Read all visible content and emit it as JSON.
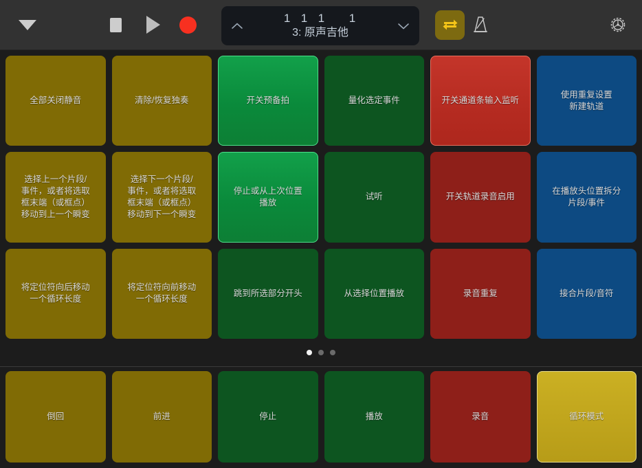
{
  "toolbar": {
    "menu_icon": "triangle-down-icon",
    "stop_icon": "stop-icon",
    "play_icon": "play-icon",
    "record_icon": "record-icon",
    "cycle_icon": "cycle-loop-icon",
    "cycle_active": true,
    "metronome_icon": "metronome-icon",
    "settings_icon": "gear-icon",
    "display": {
      "up_arrow_icon": "chevron-up-icon",
      "down_arrow_icon": "chevron-down-icon",
      "position": "1  1  1     1",
      "track": "3: 原声吉他"
    }
  },
  "colors": {
    "background": "#1c1c1c",
    "toolbar": "#323232",
    "lcd": "#15181d",
    "olive": "#806b05",
    "green": "#0d5520",
    "red": "#8e1f19",
    "blue": "#0d4a82",
    "green_active": "#0a8a3b",
    "red_active": "#b52b21",
    "olive_active": "#bfa41c",
    "cycle_badge": "#7d6a10",
    "cycle_glyph": "#f5c518",
    "record_glyph": "#f83020",
    "text": "#d8d8d8",
    "lcd_text": "#c8d2dd"
  },
  "grid": {
    "rows": [
      [
        {
          "label": "全部关闭静音",
          "color": "olive",
          "active": false
        },
        {
          "label": "清除/恢复独奏",
          "color": "olive",
          "active": false
        },
        {
          "label": "开关预备拍",
          "color": "green",
          "active": true
        },
        {
          "label": "量化选定事件",
          "color": "green",
          "active": false
        },
        {
          "label": "开关通道条输入监听",
          "color": "red",
          "active": true
        },
        {
          "label": "使用重复设置\n新建轨道",
          "color": "blue",
          "active": false
        }
      ],
      [
        {
          "label": "选择上一个片段/\n事件，或者将选取\n框末端（或框点）\n移动到上一个瞬变",
          "color": "olive",
          "active": false
        },
        {
          "label": "选择下一个片段/\n事件，或者将选取\n框末端（或框点）\n移动到下一个瞬变",
          "color": "olive",
          "active": false
        },
        {
          "label": "停止或从上次位置\n播放",
          "color": "green",
          "active": true
        },
        {
          "label": "试听",
          "color": "green",
          "active": false
        },
        {
          "label": "开关轨道录音启用",
          "color": "red",
          "active": false
        },
        {
          "label": "在播放头位置拆分\n片段/事件",
          "color": "blue",
          "active": false
        }
      ],
      [
        {
          "label": "将定位符向后移动\n一个循环长度",
          "color": "olive",
          "active": false
        },
        {
          "label": "将定位符向前移动\n一个循环长度",
          "color": "olive",
          "active": false
        },
        {
          "label": "跳到所选部分开头",
          "color": "green",
          "active": false
        },
        {
          "label": "从选择位置播放",
          "color": "green",
          "active": false
        },
        {
          "label": "录音重复",
          "color": "red",
          "active": false
        },
        {
          "label": "接合片段/音符",
          "color": "blue",
          "active": false
        }
      ]
    ]
  },
  "pager": {
    "total": 3,
    "active_index": 0
  },
  "transport": {
    "buttons": [
      {
        "label": "倒回",
        "color": "olive",
        "active": false
      },
      {
        "label": "前进",
        "color": "olive",
        "active": false
      },
      {
        "label": "停止",
        "color": "green",
        "active": false
      },
      {
        "label": "播放",
        "color": "green",
        "active": false
      },
      {
        "label": "录音",
        "color": "red",
        "active": false
      },
      {
        "label": "循环模式",
        "color": "olive",
        "active": true
      }
    ]
  }
}
